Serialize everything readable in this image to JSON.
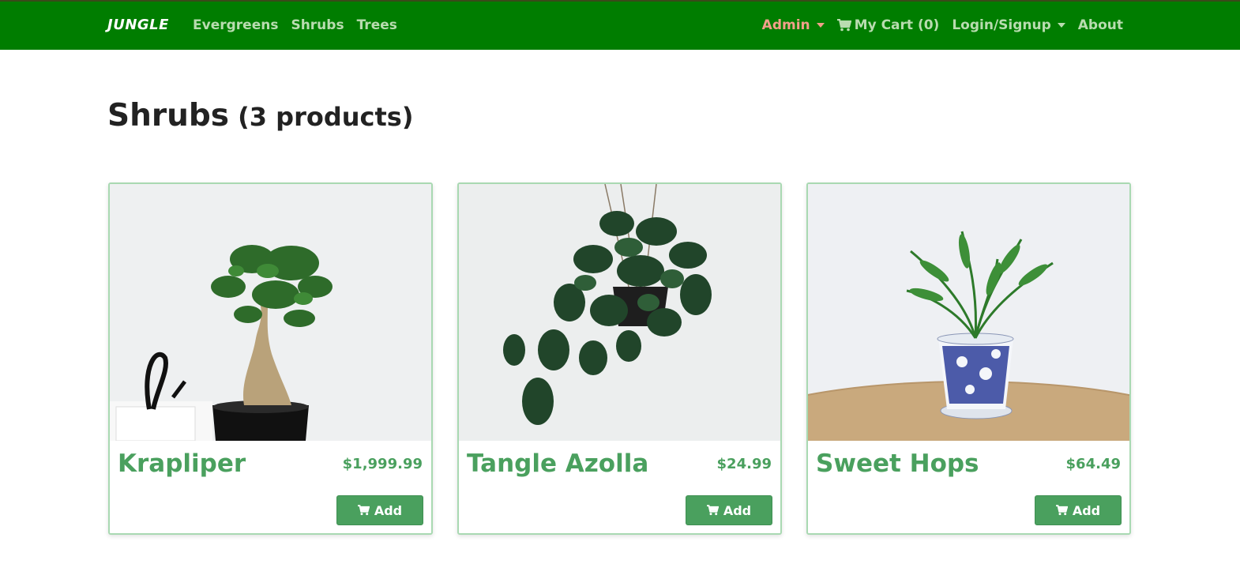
{
  "navbar": {
    "brand": "JUNGLE",
    "left_links": [
      "Evergreens",
      "Shrubs",
      "Trees"
    ],
    "admin_label": "Admin",
    "cart_label": "My Cart (0)",
    "login_label": "Login/Signup",
    "about_label": "About",
    "cart_icon": "shopping-cart-icon",
    "colors": {
      "bg": "#007d00",
      "link": "#b9dcb0",
      "admin": "#f2a08a"
    }
  },
  "heading": {
    "title": "Shrubs",
    "count": "(3 products)"
  },
  "products": [
    {
      "name": "Krapliper",
      "price": "$1,999.99",
      "button": "Add",
      "image": "bonsai-plant-photo"
    },
    {
      "name": "Tangle Azolla",
      "price": "$24.99",
      "button": "Add",
      "image": "hanging-pothos-photo"
    },
    {
      "name": "Sweet Hops",
      "price": "$64.49",
      "button": "Add",
      "image": "potted-palm-photo"
    }
  ],
  "colors": {
    "accent": "#4aa05e",
    "card_border": "#a9d9b2"
  }
}
